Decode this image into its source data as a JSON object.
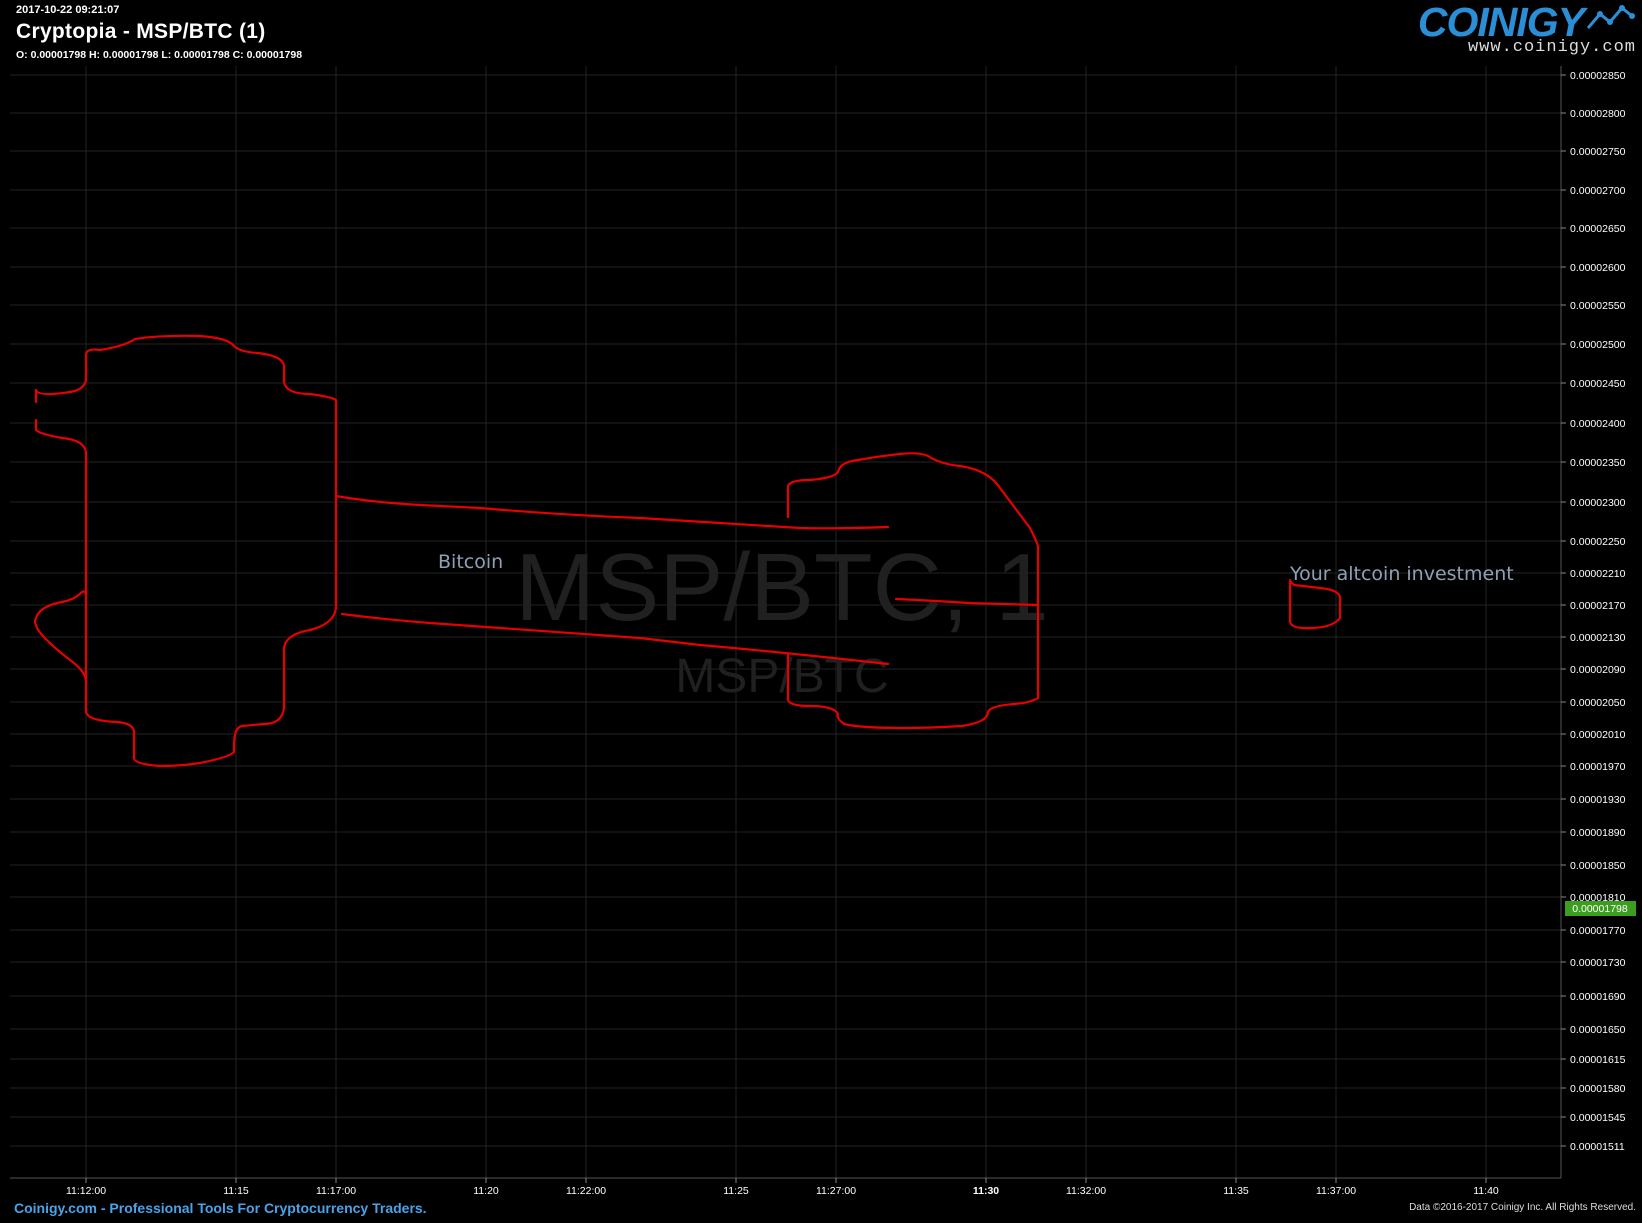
{
  "header": {
    "timestamp": "2017-10-22 09:21:07",
    "title": "Cryptopia - MSP/BTC (1)",
    "ohlc": "O: 0.00001798 H: 0.00001798 L: 0.00001798 C: 0.00001798"
  },
  "logo": {
    "wordmark": "COINIGY",
    "url": "www.coinigy.com"
  },
  "footer": {
    "left": "Coinigy.com - Professional Tools For Cryptocurrency Traders.",
    "right": "Data ©2016-2017 Coinigy Inc. All Rights Reserved."
  },
  "colors": {
    "background": "#000000",
    "grid": "#2a2a2a",
    "drawing": "#e60000",
    "price_badge": "#3c9e1f",
    "annotation": "#8fa0b6",
    "watermark": "#202020",
    "logo": "#2a8fd6",
    "footer_link": "#4aa3ea"
  },
  "chart_data": {
    "type": "line",
    "title": "",
    "watermark": {
      "main": "MSP/BTC, 1",
      "sub": "MSP/BTC"
    },
    "y_ticks": [
      "0.00002850",
      "0.00002800",
      "0.00002750",
      "0.00002700",
      "0.00002650",
      "0.00002600",
      "0.00002550",
      "0.00002500",
      "0.00002450",
      "0.00002400",
      "0.00002350",
      "0.00002300",
      "0.00002250",
      "0.00002210",
      "0.00002170",
      "0.00002130",
      "0.00002090",
      "0.00002050",
      "0.00002010",
      "0.00001970",
      "0.00001930",
      "0.00001890",
      "0.00001850",
      "0.00001810",
      "0.00001770",
      "0.00001730",
      "0.00001690",
      "0.00001650",
      "0.00001615",
      "0.00001580",
      "0.00001545",
      "0.00001511"
    ],
    "x_ticks": [
      "11:12:00",
      "11:15",
      "11:17:00",
      "11:20",
      "11:22:00",
      "11:25",
      "11:27:00",
      "11:30",
      "11:32:00",
      "11:35",
      "11:37:00",
      "11:40"
    ],
    "current_price": "0.00001798",
    "annotations": [
      {
        "text": "Bitcoin"
      },
      {
        "text": "Your altcoin investment"
      }
    ],
    "grid": true
  }
}
